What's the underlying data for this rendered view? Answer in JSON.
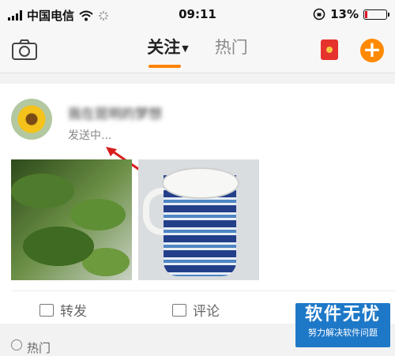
{
  "status_bar": {
    "carrier": "中国电信",
    "time": "09:11",
    "battery": "13%",
    "battery_level": 0.13
  },
  "nav": {
    "tab_following": "关注",
    "tab_hot": "热门"
  },
  "post": {
    "username": "我在昆明的梦想",
    "status": "发送中..."
  },
  "actions": {
    "repost": "转发",
    "comment": "评论"
  },
  "next_section": "热门",
  "watermark": {
    "main": "软件无忧",
    "sub": "努力解决软件问题"
  },
  "colors": {
    "accent": "#ff8200",
    "arrow": "#d91c1c"
  },
  "icons": [
    "signal-icon",
    "wifi-icon",
    "loading-icon",
    "rotation-lock-icon",
    "battery-icon",
    "camera-icon",
    "red-packet-icon",
    "add-icon",
    "repost-icon",
    "comment-icon"
  ]
}
